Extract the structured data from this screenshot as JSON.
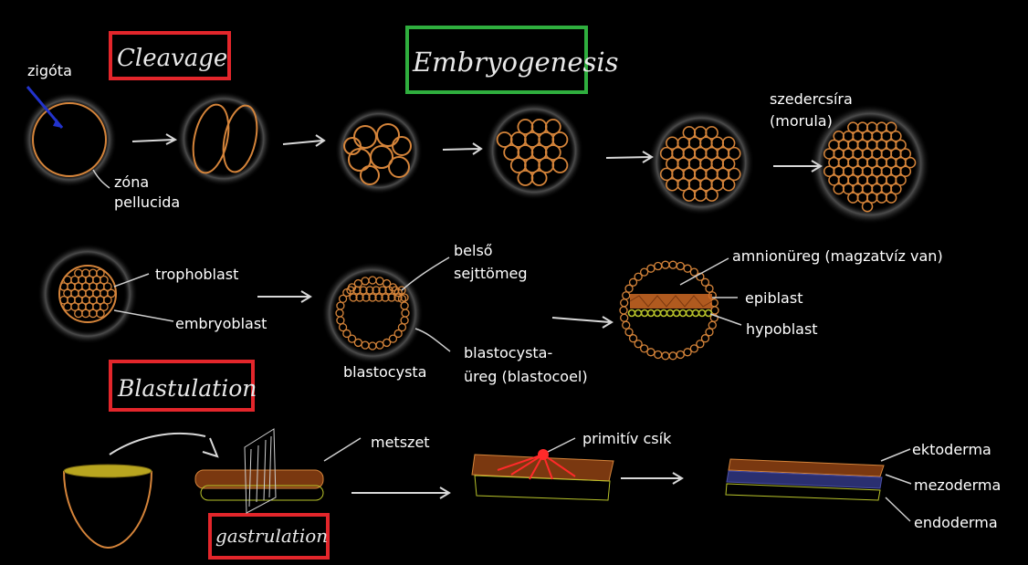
{
  "titles": {
    "cleavage": "Cleavage",
    "embryogenesis": "Embryogenesis",
    "blastulation": "Blastulation",
    "gastrulation": "gastrulation"
  },
  "box_colors": {
    "red": "#e3262b",
    "green": "#2fae3e"
  },
  "labels": {
    "zigota": "zigóta",
    "zona_1": "zóna",
    "zona_2": "pellucida",
    "morula_1": "szedercsíra",
    "morula_2": "(morula)",
    "trophoblast": "trophoblast",
    "embryoblast": "embryoblast",
    "belso_1": "belső",
    "belso_2": "sejttömeg",
    "blastocysta": "blastocysta",
    "ureg_1": "blastocysta-",
    "ureg_2": "üreg (blastocoel)",
    "amnion": "amnionüreg (magzatvíz van)",
    "epiblast": "epiblast",
    "hypoblast": "hypoblast",
    "metszet": "metszet",
    "primitiv": "primitív csík",
    "ektoderma": "ektoderma",
    "mezoderma": "mezoderma",
    "endoderma": "endoderma"
  },
  "colors": {
    "cell": "#d5843a",
    "halo": "#5a5a5a",
    "epiblast": "#cf6a25",
    "hypoblast": "#b8c32a",
    "mesoderm": "#4a4fa8",
    "streak": "#ff2a2a",
    "arrow": "#d8d8d8"
  }
}
